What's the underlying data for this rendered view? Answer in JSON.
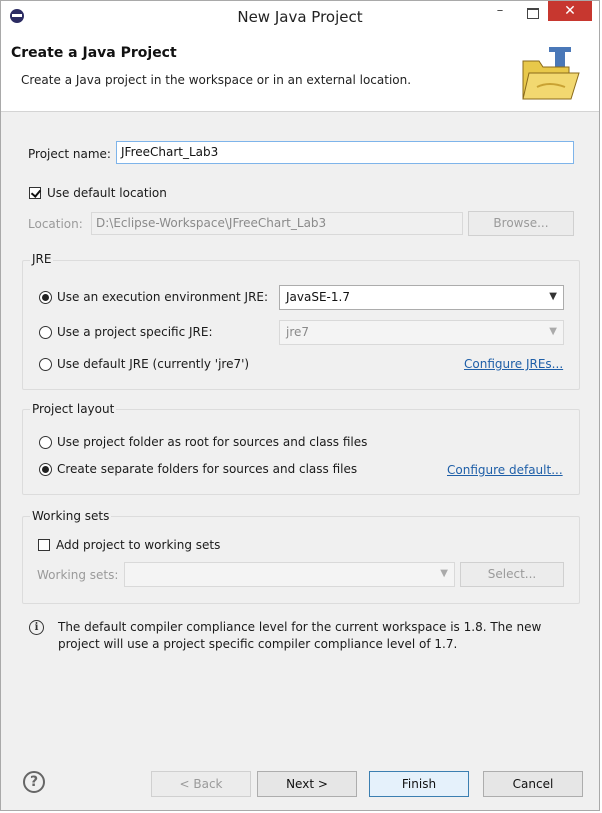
{
  "window": {
    "title": "New Java Project",
    "minimize": "–",
    "close": "✕"
  },
  "header": {
    "title": "Create a Java Project",
    "description": "Create a Java project in the workspace or in an external location."
  },
  "project": {
    "name_label": "Project name:",
    "name_value": "JFreeChart_Lab3",
    "default_location_label": "Use default location",
    "default_location_checked": true,
    "location_label": "Location:",
    "location_value": "D:\\Eclipse-Workspace\\JFreeChart_Lab3",
    "browse_label": "Browse..."
  },
  "jre": {
    "group_title": "JRE",
    "option_env_label": "Use an execution environment JRE:",
    "env_value": "JavaSE-1.7",
    "option_specific_label": "Use a project specific JRE:",
    "specific_value": "jre7",
    "option_default_label": "Use default JRE (currently 'jre7')",
    "configure_link": "Configure JREs..."
  },
  "layout": {
    "group_title": "Project layout",
    "option_root_label": "Use project folder as root for sources and class files",
    "option_separate_label": "Create separate folders for sources and class files",
    "configure_link": "Configure default..."
  },
  "working_sets": {
    "group_title": "Working sets",
    "add_label": "Add project to working sets",
    "sets_label": "Working sets:",
    "select_label": "Select..."
  },
  "info": {
    "line1": "The default compiler compliance level for the current workspace is 1.8. The new",
    "line2": "project will use a project specific compiler compliance level of 1.7."
  },
  "footer": {
    "help": "?",
    "back": "< Back",
    "next": "Next >",
    "finish": "Finish",
    "cancel": "Cancel"
  },
  "icons": {
    "app": "eclipse-icon",
    "header": "java-project-folder-icon",
    "info": "info-icon",
    "help": "help-icon",
    "dropdown": "chevron-down-icon"
  },
  "colors": {
    "link": "#1f5fa8",
    "close_button": "#c7372f",
    "focus_border": "#7eb4ea",
    "dialog_bg": "#f0f0f0"
  }
}
